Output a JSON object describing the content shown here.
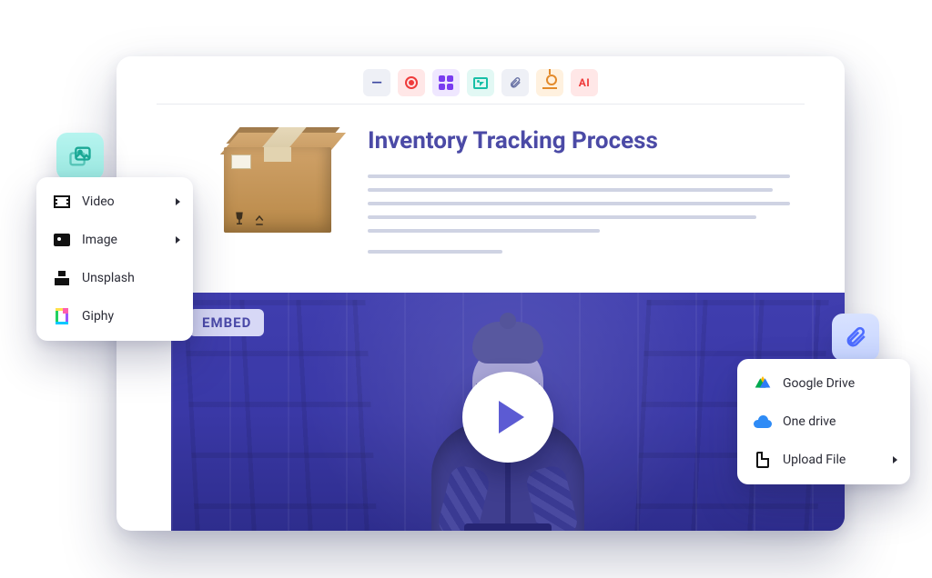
{
  "toolbar": {
    "dash_label": "—",
    "ai_label": "AI",
    "icons": {
      "record": "record-icon",
      "grid": "table-icon",
      "media": "media-icon",
      "attach": "paperclip-icon",
      "hand": "insert-icon",
      "ai": "ai-icon"
    }
  },
  "document": {
    "title": "Inventory Tracking Process",
    "hero_image": "cardboard-box"
  },
  "embed": {
    "badge": "EMBED",
    "play_label": "Play video"
  },
  "media_menu": {
    "fab_icon": "media-gallery-icon",
    "items": [
      {
        "label": "Video",
        "icon": "film-icon",
        "submenu": true
      },
      {
        "label": "Image",
        "icon": "image-icon",
        "submenu": true
      },
      {
        "label": "Unsplash",
        "icon": "unsplash-icon",
        "submenu": false
      },
      {
        "label": "Giphy",
        "icon": "giphy-icon",
        "submenu": false
      }
    ]
  },
  "attach_menu": {
    "fab_icon": "paperclip-icon",
    "items": [
      {
        "label": "Google Drive",
        "icon": "google-drive-icon",
        "submenu": false
      },
      {
        "label": "One drive",
        "icon": "onedrive-icon",
        "submenu": false
      },
      {
        "label": "Upload File",
        "icon": "file-icon",
        "submenu": true
      }
    ]
  },
  "colors": {
    "title": "#4b4aa6",
    "embed_bg": "#3a3aa9",
    "play_triangle": "#5c5bd3"
  }
}
